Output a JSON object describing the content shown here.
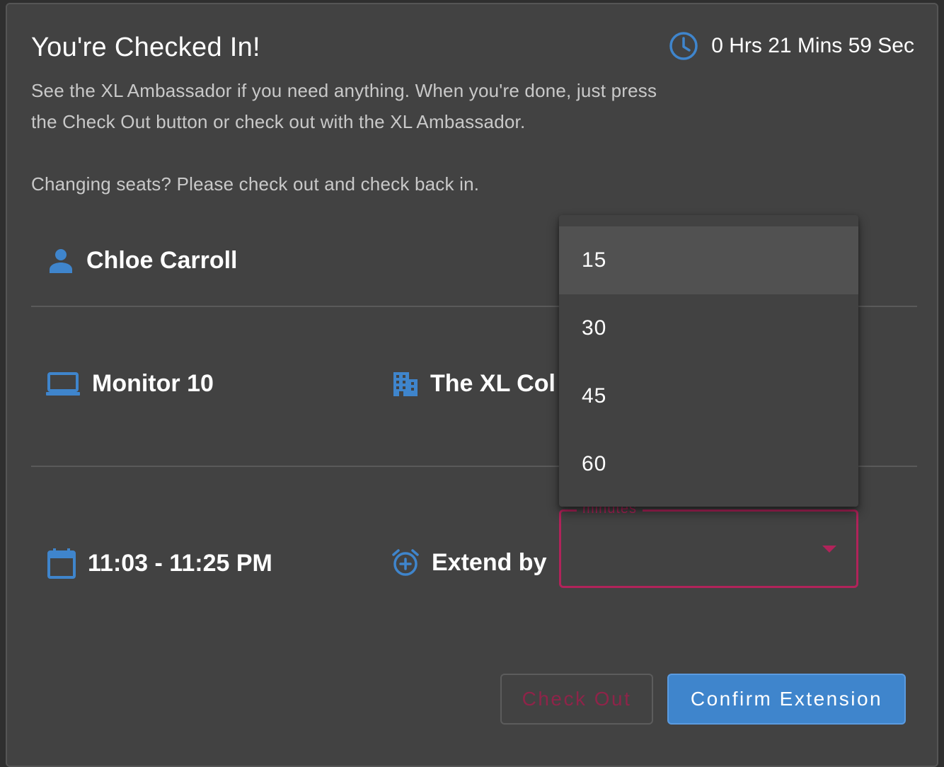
{
  "header": {
    "title": "You're Checked In!",
    "timer": "0 Hrs 21 Mins 59 Sec"
  },
  "description": {
    "line1": "See the XL Ambassador if you need anything. When you're done, just press the Check Out button or check out with the XL Ambassador.",
    "line2": "Changing seats? Please check out and check back in."
  },
  "details": {
    "user_name": "Chloe Carroll",
    "device": "Monitor 10",
    "location": "The XL Collective",
    "time_range": "11:03 - 11:25 PM",
    "extend_label": "Extend by"
  },
  "extend_select": {
    "label": "minutes",
    "value": "",
    "options": [
      "15",
      "30",
      "45",
      "60"
    ],
    "highlighted": "15"
  },
  "actions": {
    "check_out": "Check Out",
    "confirm_extension": "Confirm Extension"
  },
  "colors": {
    "accent_blue": "#3f85cc",
    "error_pink": "#b1235a",
    "background": "#424242"
  }
}
